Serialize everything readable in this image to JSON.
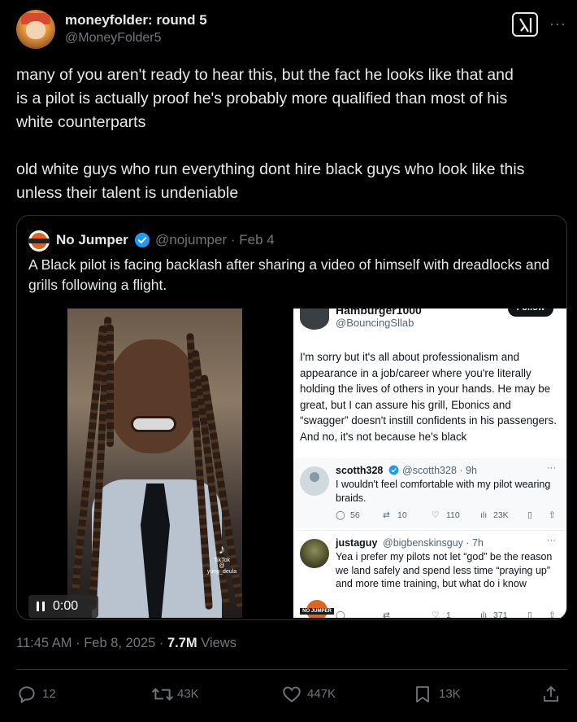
{
  "post": {
    "author_name": "moneyfolder: round 5",
    "author_handle": "@MoneyFolder5",
    "paragraph1": "many of you aren't ready to hear this, but the fact he looks like that and\nis a pilot is actually proof he's probably more qualified than most of his\nwhite counterparts",
    "paragraph2": "old white guys who run everything dont hire black guys who look like this\nunless their talent is undeniable",
    "time": "11:45 AM",
    "date": "Feb 8, 2025",
    "views_count": "7.7M",
    "views_label": "Views"
  },
  "quote": {
    "author_name": "No Jumper",
    "meta": "@nojumper · Feb 4",
    "text": "A Black pilot is facing backlash after sharing a video of himself with dreadlocks and grills following a flight.",
    "video": {
      "time": "0:00",
      "tiktok_label": "TikTok",
      "tiktok_handle": "@ yung_deula"
    },
    "screenshot": {
      "top_name": "Hamburger1000",
      "top_handle": "@BouncingSllab",
      "follow_label": "Follow",
      "body": "I'm sorry but it's all about professionalism and appearance in a job/career where you're literally holding the lives of others in your hands. He may be great, but I can assure his grill, Ebonics and “swagger” doesn't instill confidents in his passengers. And no, it's not because he's black",
      "replies": [
        {
          "name": "scotth328",
          "handle": "@scotth328 · 9h",
          "text": "I wouldn't feel comfortable with my pilot wearing braids.",
          "replies": "56",
          "reposts": "10",
          "likes": "110",
          "views": "23K"
        },
        {
          "name": "justaguy",
          "handle": "@bigbenskinsguy · 7h",
          "text": "Yea i prefer my pilots not let “god” be the reason we land safely and spend less time “praying up” and more time training, but what do i know",
          "replies": "",
          "reposts": "",
          "likes": "1",
          "views": "371"
        }
      ],
      "logo_text": "NO JUMPER"
    }
  },
  "actions": {
    "replies": "12",
    "reposts": "43K",
    "likes": "447K",
    "bookmarks": "13K"
  },
  "colors": {
    "background": "#000000",
    "text": "#e7e9ea",
    "muted": "#71767b",
    "border": "#2f3336",
    "verified": "#1d9bf0"
  }
}
